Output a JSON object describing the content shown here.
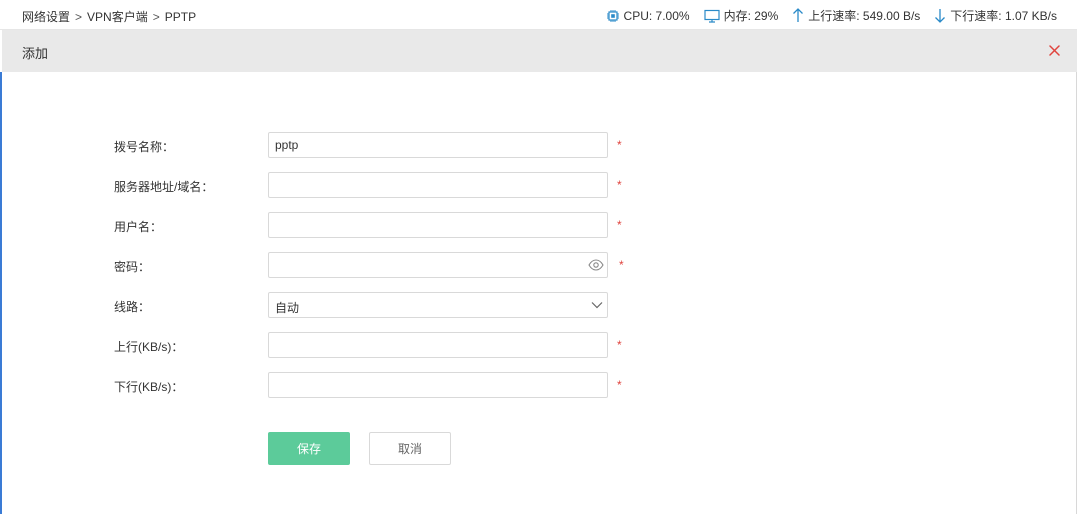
{
  "breadcrumb": {
    "items": [
      "网络设置",
      "VPN客户端",
      "PPTP"
    ],
    "separator": ">"
  },
  "stats": {
    "cpu": "CPU: 7.00%",
    "memory": "内存: 29%",
    "upload": "上行速率: 549.00 B/s",
    "download": "下行速率: 1.07 KB/s"
  },
  "dialog": {
    "title": "添加",
    "close_icon": "close-icon"
  },
  "form": {
    "dial_name": {
      "label": "拨号名称：",
      "value": "pptp",
      "required_mark": "*"
    },
    "server": {
      "label": "服务器地址/域名：",
      "value": "",
      "required_mark": "*"
    },
    "username": {
      "label": "用户名：",
      "value": "",
      "required_mark": "*"
    },
    "password": {
      "label": "密码：",
      "value": "",
      "required_mark": "*"
    },
    "line": {
      "label": "线路：",
      "selected": "自动"
    },
    "upload": {
      "label": "上行(KB/s)：",
      "value": "",
      "required_mark": "*"
    },
    "download": {
      "label": "下行(KB/s)：",
      "value": "",
      "required_mark": "*"
    }
  },
  "buttons": {
    "save": "保存",
    "cancel": "取消"
  },
  "colors": {
    "accent": "#5ccb9a",
    "close": "#e0443e",
    "required": "#e0443e",
    "icon_blue": "#2a8ac8"
  }
}
